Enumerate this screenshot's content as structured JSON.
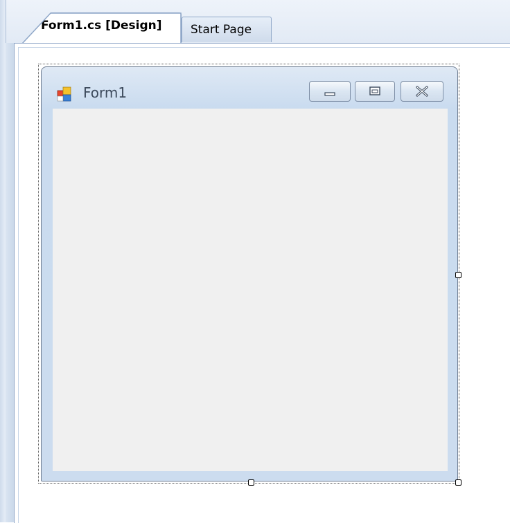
{
  "tabs": [
    {
      "label": "Form1.cs [Design]",
      "active": true
    },
    {
      "label": "Start Page",
      "active": false
    }
  ],
  "form": {
    "title": "Form1",
    "icon": "form-app-icon",
    "caption_buttons": [
      "minimize-icon",
      "maximize-icon",
      "close-icon"
    ],
    "client_color": "#f0f0f0"
  },
  "colors": {
    "frame_blue": "#8fa7c8",
    "title_gradient_top": "#dfe9f5",
    "title_gradient_bottom": "#c9dbef"
  }
}
